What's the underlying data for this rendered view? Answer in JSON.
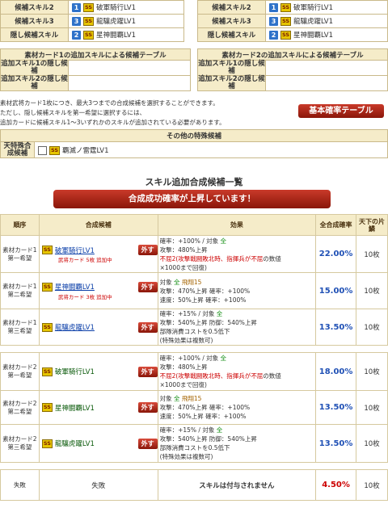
{
  "top_left": [
    {
      "label": "候補スキル2",
      "num": "1",
      "skill": "破軍騎行LV1"
    },
    {
      "label": "候補スキル3",
      "num": "3",
      "skill": "龍驤虎躍LV1"
    },
    {
      "label": "隠し候補スキル",
      "num": "2",
      "skill": "星神闘覇LV1"
    }
  ],
  "top_right": [
    {
      "label": "候補スキル2",
      "num": "1",
      "skill": "破軍騎行LV1"
    },
    {
      "label": "候補スキル3",
      "num": "3",
      "skill": "龍驤虎躍LV1"
    },
    {
      "label": "隠し候補スキル",
      "num": "2",
      "skill": "星神闘覇LV1"
    }
  ],
  "ss_badge": "SS",
  "add_left": {
    "title": "素材カード1の追加スキルによる候補テーブル",
    "row1": "追加スキル1の隠し候補",
    "row2": "追加スキル2の隠し候補"
  },
  "add_right": {
    "title": "素材カード2の追加スキルによる候補テーブル",
    "row1": "追加スキル1の隠し候補",
    "row2": "追加スキル2の隠し候補"
  },
  "notes": [
    "素材武将カード1枚につき、最大3つまでの合成候補を選択することができます。",
    "ただし、隠し候補スキルを第一希望に選択するには、",
    "追加カードに候補スキル1〜3いずれかのスキルが追加されている必要があります。"
  ],
  "table_button": "基本確率テーブル",
  "special": {
    "title": "その他の特殊候補",
    "label": "天特殊合成候補",
    "skill": "覇滅ノ雷霆LV1"
  },
  "list_title": "スキル追加合成候補一覧",
  "success_banner": "合成成功確率が上昇しています！",
  "headers": {
    "order": "順序",
    "candidate": "合成候補",
    "effect": "効果",
    "rate": "全合成確率",
    "total": "天下の片鱗"
  },
  "remove_label": "外す",
  "rows": [
    {
      "src1": "素材カード1",
      "src2": "第一希望",
      "skill": "破軍騎行LV1",
      "linked": true,
      "sub": "武将カード 5枚 追加中",
      "eff": [
        [
          [
            "確率：+100% / 対象 ",
            ""
          ],
          [
            "全",
            "g"
          ]
        ],
        [
          [
            "攻撃：480%上昇",
            ""
          ]
        ],
        [
          [
            "不屈2",
            "r"
          ],
          [
            "(攻撃戦闘敗北時、指揮兵が",
            "r"
          ],
          [
            "不屈",
            "r"
          ],
          [
            "の数値",
            ""
          ]
        ],
        [
          [
            "×1000まで回復)",
            ""
          ]
        ]
      ],
      "pct": "22.00%",
      "cnt": "10枚"
    },
    {
      "src1": "素材カード1",
      "src2": "第二希望",
      "skill": "星神闘覇LV1",
      "linked": true,
      "sub": "武将カード 3枚 追加中",
      "eff": [
        [
          [
            "対象 ",
            ""
          ],
          [
            "全",
            "g"
          ],
          [
            " 飛翔15",
            "o"
          ]
        ],
        [
          [
            "攻撃：470%上昇 確率：+100%",
            ""
          ]
        ],
        [
          [
            "速度：50%上昇 確率：+100%",
            ""
          ]
        ]
      ],
      "pct": "15.00%",
      "cnt": "10枚"
    },
    {
      "src1": "素材カード1",
      "src2": "第三希望",
      "skill": "龍驤虎躍LV1",
      "linked": true,
      "sub": "",
      "eff": [
        [
          [
            "確率：+15% / 対象 ",
            ""
          ],
          [
            "全",
            "g"
          ]
        ],
        [
          [
            "攻撃：540%上昇 防御：540%上昇",
            ""
          ]
        ],
        [
          [
            "部隊消費コストを0.5低下",
            ""
          ]
        ],
        [
          [
            "(特殊効果は複数可)",
            ""
          ]
        ]
      ],
      "pct": "13.50%",
      "cnt": "10枚"
    },
    {
      "src1": "素材カード2",
      "src2": "第一希望",
      "skill": "破軍騎行LV1",
      "linked": false,
      "sub": "",
      "eff": [
        [
          [
            "確率：+100% / 対象 ",
            ""
          ],
          [
            "全",
            "g"
          ]
        ],
        [
          [
            "攻撃：480%上昇",
            ""
          ]
        ],
        [
          [
            "不屈2",
            "r"
          ],
          [
            "(攻撃戦闘敗北時、指揮兵が",
            "r"
          ],
          [
            "不屈",
            "r"
          ],
          [
            "の数値",
            ""
          ]
        ],
        [
          [
            "×1000まで回復)",
            ""
          ]
        ]
      ],
      "pct": "18.00%",
      "cnt": "10枚"
    },
    {
      "src1": "素材カード2",
      "src2": "第二希望",
      "skill": "星神闘覇LV1",
      "linked": false,
      "sub": "",
      "eff": [
        [
          [
            "対象 ",
            ""
          ],
          [
            "全",
            "g"
          ],
          [
            " 飛翔15",
            "o"
          ]
        ],
        [
          [
            "攻撃：470%上昇 確率：+100%",
            ""
          ]
        ],
        [
          [
            "速度：50%上昇 確率：+100%",
            ""
          ]
        ]
      ],
      "pct": "13.50%",
      "cnt": "10枚"
    },
    {
      "src1": "素材カード2",
      "src2": "第三希望",
      "skill": "龍驤虎躍LV1",
      "linked": false,
      "sub": "",
      "eff": [
        [
          [
            "確率：+15% / 対象 ",
            ""
          ],
          [
            "全",
            "g"
          ]
        ],
        [
          [
            "攻撃：540%上昇 防御：540%上昇",
            ""
          ]
        ],
        [
          [
            "部隊消費コストを0.5低下",
            ""
          ]
        ],
        [
          [
            "(特殊効果は複数可)",
            ""
          ]
        ]
      ],
      "pct": "13.50%",
      "cnt": "10枚"
    }
  ],
  "fail": {
    "order": "失敗",
    "candidate": "失敗",
    "effect": "スキルは付与されません",
    "pct": "4.50%",
    "cnt": "10枚"
  }
}
